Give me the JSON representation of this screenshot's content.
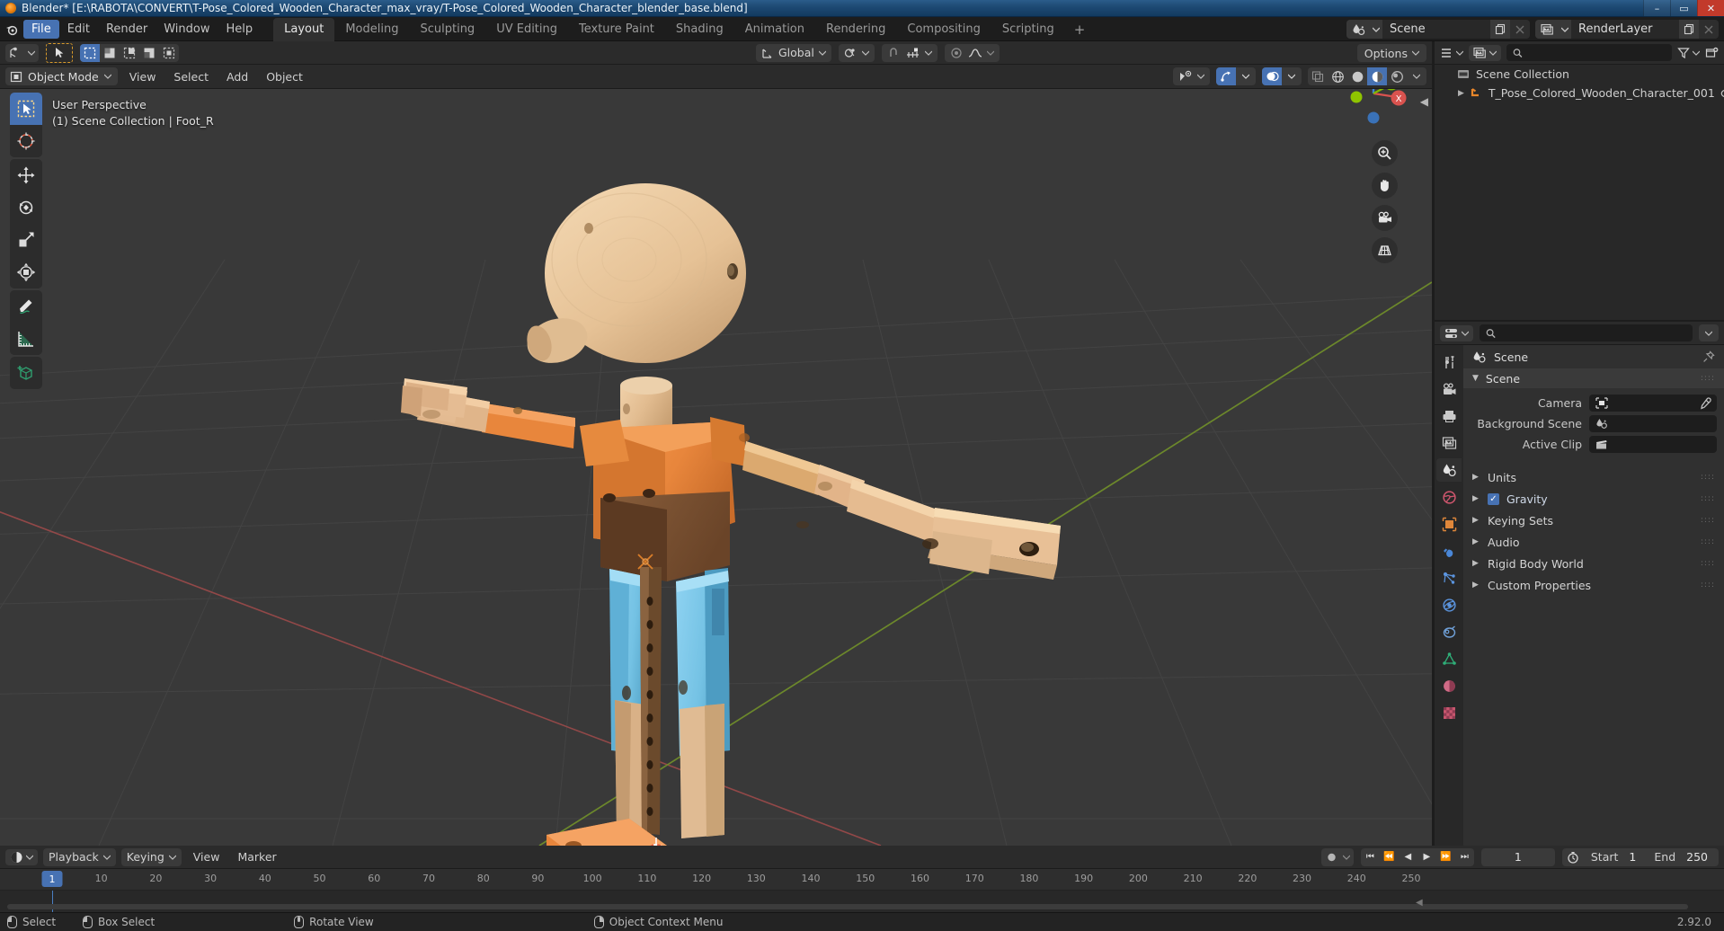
{
  "window": {
    "title": "Blender* [E:\\RABOTA\\CONVERT\\T-Pose_Colored_Wooden_Character_max_vray/T-Pose_Colored_Wooden_Character_blender_base.blend]",
    "minimize": "–",
    "maximize": "▭",
    "close": "✕"
  },
  "topbar": {
    "menus": [
      "File",
      "Edit",
      "Render",
      "Window",
      "Help"
    ],
    "active_menu": "File",
    "workspaces": [
      "Layout",
      "Modeling",
      "Sculpting",
      "UV Editing",
      "Texture Paint",
      "Shading",
      "Animation",
      "Rendering",
      "Compositing",
      "Scripting"
    ],
    "active_workspace": "Layout",
    "add_workspace": "+",
    "scene_name": "Scene",
    "view_layer_name": "RenderLayer",
    "scene_icon": "scene-icon",
    "view_layer_icon": "view-layer-icon",
    "copy_icon": "new-copy-icon",
    "unlink_icon": "unlink-x-icon"
  },
  "viewport": {
    "mode": "Object Mode",
    "menus": [
      "View",
      "Select",
      "Add",
      "Object"
    ],
    "transform_orientation": "Global",
    "options_label": "Options",
    "overlay_line1": "User Perspective",
    "overlay_line2": "(1) Scene Collection | Foot_R",
    "select_modes": [
      "tweak-select-icon",
      "box-select-icon",
      "circle-select-icon",
      "lasso-select-icon",
      "select-extend-icon"
    ],
    "toolbar_tools": [
      "select-box-tool-icon",
      "cursor-tool-icon",
      "move-tool-icon",
      "rotate-tool-icon",
      "scale-tool-icon",
      "transform-tool-icon",
      "annotate-tool-icon",
      "measure-tool-icon",
      "add-cube-tool-icon"
    ],
    "active_tool": "select-box-tool-icon",
    "gizmo_axes": [
      "X",
      "Y",
      "Z"
    ],
    "nav_buttons": [
      "zoom-icon",
      "pan-hand-icon",
      "camera-view-icon",
      "toggle-perspective-icon"
    ],
    "shading_modes": [
      "wireframe-shading-icon",
      "solid-shading-icon",
      "material-preview-icon",
      "rendered-shading-icon"
    ],
    "active_shading": "material-preview-icon",
    "collapse_icon": "sidebar-collapse-icon"
  },
  "outliner": {
    "display_mode_icon": "outliner-display-mode-icon",
    "filter_icon": "filter-funnel-icon",
    "new_collection_icon": "new-collection-icon",
    "search_placeholder": "",
    "rows": [
      {
        "label": "Scene Collection",
        "icon": "scene-collection-icon",
        "indent": 0,
        "expandable": false,
        "eye": false
      },
      {
        "label": "T_Pose_Colored_Wooden_Character_001",
        "icon": "empty-object-icon",
        "indent": 1,
        "expandable": true,
        "eye": true
      }
    ]
  },
  "properties": {
    "editor_icon": "properties-editor-icon",
    "search_placeholder": "",
    "breadcrumb": "Scene",
    "breadcrumb_icon": "scene-icon",
    "pin_icon": "pin-icon",
    "panel_title": "Scene",
    "tabs": [
      "tool-icon",
      "render-icon",
      "output-icon",
      "view-layer-icon",
      "scene-icon",
      "world-icon",
      "object-icon",
      "modifier-icon",
      "particles-icon",
      "physics-icon",
      "constraint-icon",
      "object-data-icon",
      "material-icon",
      "texture-icon"
    ],
    "active_tab": "scene-icon",
    "fields": [
      {
        "label": "Camera",
        "value": "",
        "icon": "camera-field-icon",
        "has_eyedropper": true
      },
      {
        "label": "Background Scene",
        "value": "",
        "icon": "scene-icon",
        "has_eyedropper": false
      },
      {
        "label": "Active Clip",
        "value": "",
        "icon": "clip-icon",
        "has_eyedropper": false
      }
    ],
    "sections": [
      {
        "label": "Units",
        "checkbox": false
      },
      {
        "label": "Gravity",
        "checkbox": true,
        "checked": true
      },
      {
        "label": "Keying Sets",
        "checkbox": false
      },
      {
        "label": "Audio",
        "checkbox": false
      },
      {
        "label": "Rigid Body World",
        "checkbox": false
      },
      {
        "label": "Custom Properties",
        "checkbox": false
      }
    ]
  },
  "timeline": {
    "editor_icon": "timeline-editor-icon",
    "menus": [
      "Playback",
      "Keying",
      "View",
      "Marker"
    ],
    "auto_key_icon": "record-dot-icon",
    "transport": [
      "jump-start-icon",
      "prev-keyframe-icon",
      "play-reverse-icon",
      "play-icon",
      "next-keyframe-icon",
      "jump-end-icon"
    ],
    "current_frame": "1",
    "frame_range_icon": "stopwatch-icon",
    "start_label": "Start",
    "start_value": "1",
    "end_label": "End",
    "end_value": "250",
    "ticks": [
      10,
      20,
      30,
      40,
      50,
      60,
      70,
      80,
      90,
      100,
      110,
      120,
      130,
      140,
      150,
      160,
      170,
      180,
      190,
      200,
      210,
      220,
      230,
      240,
      250
    ],
    "playhead_frame": 1
  },
  "statusbar": {
    "items": [
      {
        "mouse": "left",
        "label": "Select"
      },
      {
        "mouse": "left-drag",
        "label": "Box Select"
      },
      {
        "mouse": "middle",
        "label": "Rotate View"
      },
      {
        "mouse": "right",
        "label": "Object Context Menu"
      }
    ],
    "version": "2.92.0"
  },
  "colors": {
    "accent_blue": "#4772b3",
    "viewport_bg": "#393939",
    "panel_bg": "#303030",
    "header_bg": "#2b2b2b",
    "orange_body": "#e8863c",
    "wood_light": "#e8c49a",
    "blue_legs": "#78c4e8",
    "axis_x_red": "#d9534f",
    "axis_y_green": "#7fb800",
    "axis_z_blue": "#3b82d6"
  }
}
